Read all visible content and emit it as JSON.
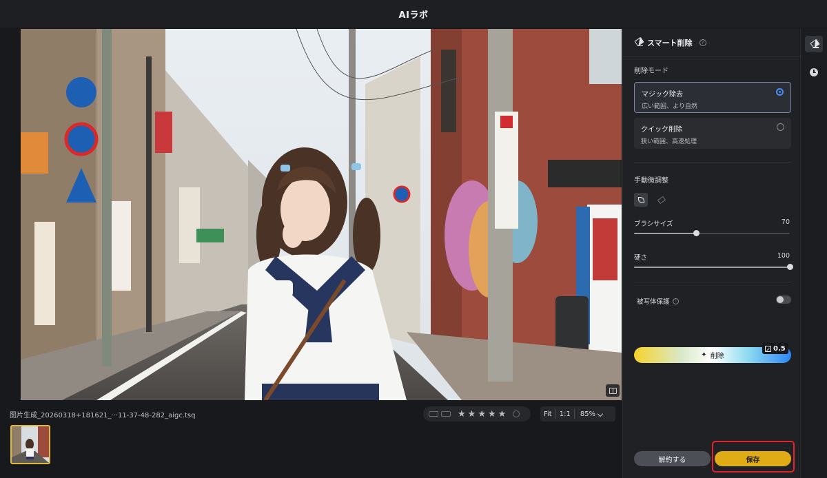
{
  "app": {
    "title": "AIラボ"
  },
  "photo": {
    "alt_icon": "street-photo"
  },
  "bottom": {
    "filename": "图片生成_20260318+181621_···11-37-48-282_aigc.tsq",
    "rating": {
      "stars": [
        "★",
        "★",
        "★",
        "★",
        "★"
      ]
    },
    "zoom": {
      "fit": "Fit",
      "one_to_one": "1:1",
      "value": "85%"
    }
  },
  "panel": {
    "header": "スマート削除",
    "help_glyph": "?",
    "mode_label": "削除モード",
    "modes": [
      {
        "name": "マジック除去",
        "desc": "広い範囲、より自然",
        "selected": true
      },
      {
        "name": "クイック削除",
        "desc": "狭い範囲、高速処理",
        "selected": false
      }
    ],
    "manual_label": "手動微調整",
    "brush_size": {
      "label": "ブラシサイズ",
      "value": "70",
      "fraction": 0.4
    },
    "hardness": {
      "label": "硬さ",
      "value": "100",
      "fraction": 1.0
    },
    "subject_protect": {
      "label": "被写体保護",
      "info_glyph": "i",
      "on": false
    },
    "erase_button": {
      "label": "削除",
      "icon": "✦"
    },
    "credit": {
      "value": "0.5"
    },
    "cancel_label": "解約する",
    "save_label": "保存"
  },
  "rail": {
    "items": [
      "eraser-icon",
      "history-icon"
    ]
  }
}
